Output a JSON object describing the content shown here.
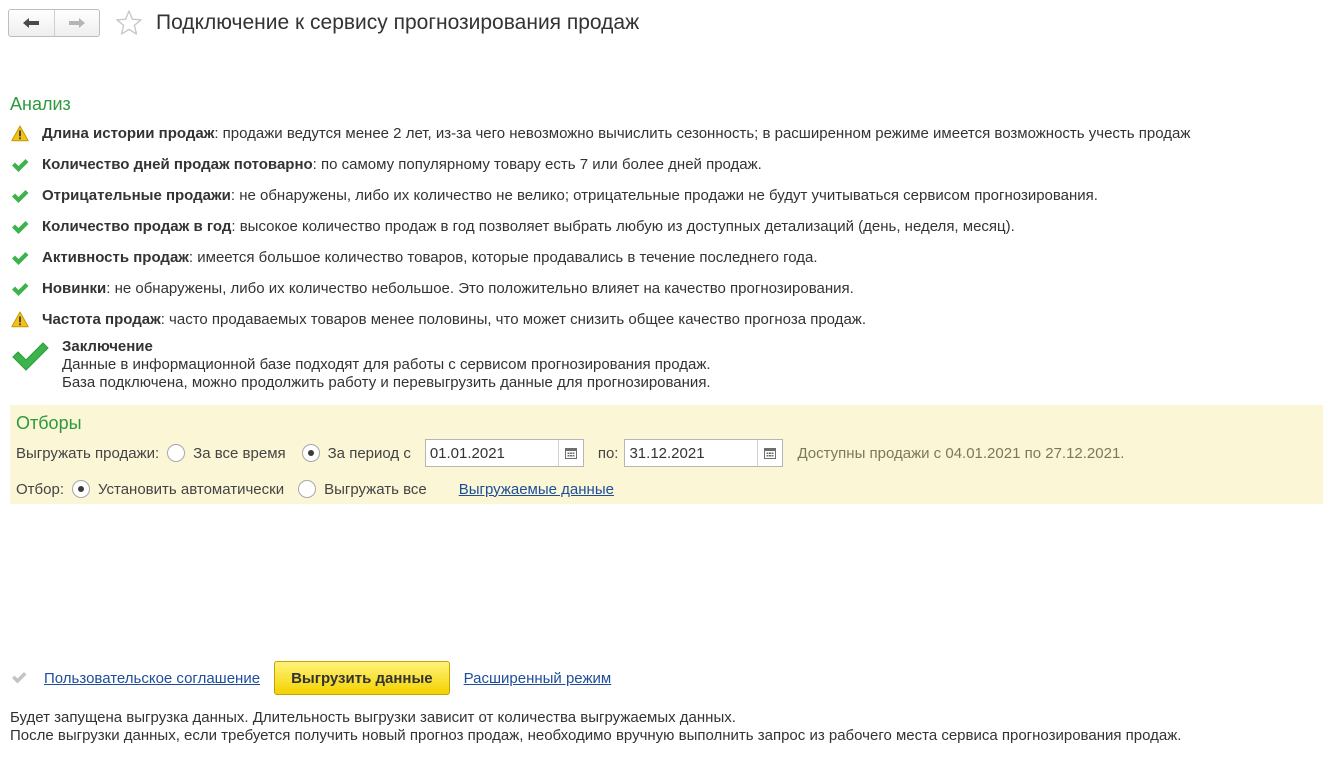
{
  "header": {
    "title": "Подключение к сервису прогнозирования продаж"
  },
  "analysis": {
    "title": "Анализ",
    "checks": [
      {
        "status": "warning",
        "icon": "warning-icon",
        "name": "Длина истории продаж",
        "text": ": продажи ведутся менее 2 лет, из-за чего невозможно вычислить сезонность; в расширенном режиме имеется возможность учесть продаж"
      },
      {
        "status": "ok",
        "icon": "check-icon",
        "name": "Количество дней продаж потоварно",
        "text": ": по самому популярному товару есть 7 или более дней продаж."
      },
      {
        "status": "ok",
        "icon": "check-icon",
        "name": "Отрицательные продажи",
        "text": ": не обнаружены, либо их количество не велико; отрицательные продажи не будут учитываться сервисом прогнозирования."
      },
      {
        "status": "ok",
        "icon": "check-icon",
        "name": "Количество продаж в год",
        "text": ": высокое количество продаж в год позволяет выбрать любую из доступных детализаций (день, неделя, месяц)."
      },
      {
        "status": "ok",
        "icon": "check-icon",
        "name": "Активность продаж",
        "text": ": имеется большое количество товаров, которые продавались в течение последнего года."
      },
      {
        "status": "ok",
        "icon": "check-icon",
        "name": "Новинки",
        "text": ": не обнаружены, либо их количество небольшое. Это положительно влияет на качество прогнозирования."
      },
      {
        "status": "warning",
        "icon": "warning-icon",
        "name": "Частота продаж",
        "text": ": часто продаваемых товаров менее половины, что может снизить общее качество прогноза продаж."
      }
    ],
    "conclusion": {
      "title": "Заключение",
      "line1": "Данные в информационной базе подходят для работы с сервисом прогнозирования продаж.",
      "line2": "База подключена, можно продолжить работу и перевыгрузить данные для прогнозирования."
    }
  },
  "filters": {
    "title": "Отборы",
    "export_label": "Выгружать продажи:",
    "option_all_time": "За все время",
    "option_period": "За период с",
    "selected_period_mode": "period",
    "date_from": "01.01.2021",
    "to_label": "по:",
    "date_to": "31.12.2021",
    "available_note": "Доступны продажи с 04.01.2021 по 27.12.2021.",
    "selection_label": "Отбор:",
    "option_auto": "Установить автоматически",
    "option_export_all": "Выгружать все",
    "selected_selection_mode": "auto",
    "exported_data_link": "Выгружаемые данные"
  },
  "bottom": {
    "agreement_checked": true,
    "agreement_link": "Пользовательское соглашение",
    "export_button": "Выгрузить данные",
    "advanced_link": "Расширенный режим",
    "info_line1": "Будет запущена выгрузка данных. Длительность выгрузки зависит от количества выгружаемых данных.",
    "info_line2": "После выгрузки данных, если требуется получить новый прогноз продаж, необходимо вручную выполнить запрос из рабочего места сервиса прогнозирования продаж."
  },
  "colors": {
    "accent_green": "#2c9a3d",
    "check_green": "#3cb44b",
    "warning_yellow": "#f2c11a",
    "filters_background": "#fbf6d6",
    "primary_button": "#f3d300",
    "link": "#1d4e9a"
  }
}
